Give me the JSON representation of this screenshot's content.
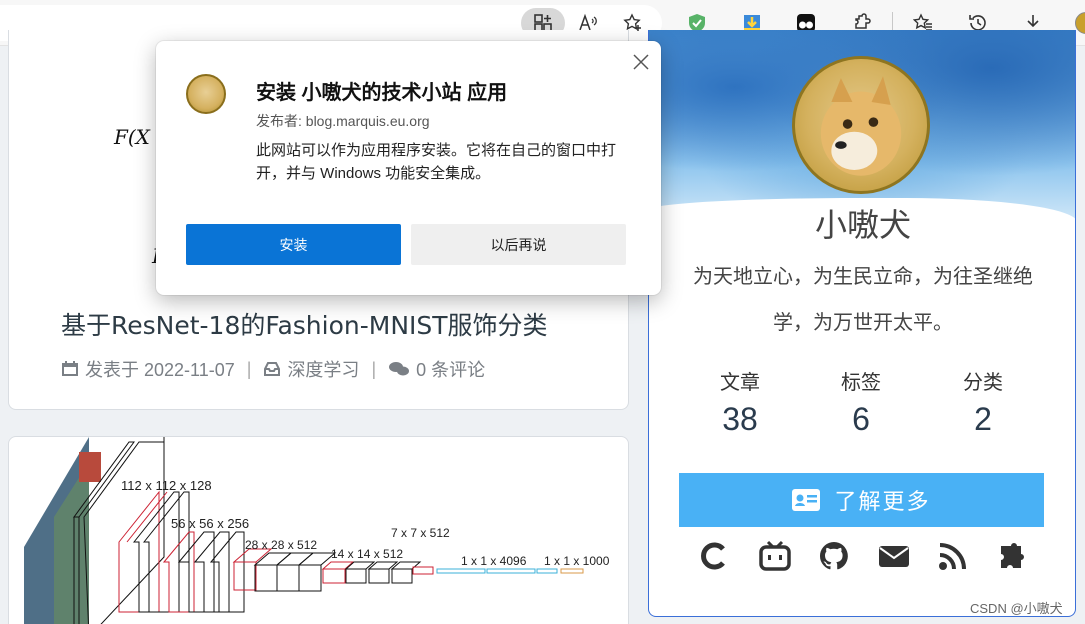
{
  "toolbar": {
    "icons": [
      "app-available-icon",
      "read-aloud-icon",
      "add-favorite-icon",
      "adguard-extension-icon",
      "download-extension-icon",
      "tampermonkey-extension-icon",
      "extensions-icon",
      "favorites-icon",
      "history-icon",
      "downloads-icon",
      "profile-avatar"
    ]
  },
  "post1": {
    "formula_top": "F(X",
    "formula_bottom": "F",
    "title": "基于ResNet-18的Fashion-MNIST服饰分类",
    "date_label": "发表于 2022-11-07",
    "separator": "|",
    "category": "深度学习",
    "comments": "0 条评论"
  },
  "post2": {
    "labels": [
      "112 x 112 x 128",
      "56 x 56 x 256",
      "28 x 28 x 512",
      "14 x 14 x 512",
      "7 x 7 x 512",
      "1 x 1 x 4096",
      "1 x 1 x 1000"
    ]
  },
  "profile": {
    "name": "小嗷犬",
    "motto": "为天地立心，为生民立命，为往圣继绝学，为万世开太平。",
    "stats": [
      {
        "label": "文章",
        "value": "38"
      },
      {
        "label": "标签",
        "value": "6"
      },
      {
        "label": "分类",
        "value": "2"
      }
    ],
    "learn_more": "了解更多",
    "social_icons": [
      "csdn-icon",
      "bilibili-icon",
      "github-icon",
      "email-icon",
      "rss-icon",
      "puzzle-icon"
    ]
  },
  "popup": {
    "title": "安装 小嗷犬的技术小站 应用",
    "publisher": "发布者: blog.marquis.eu.org",
    "description": "此网站可以作为应用程序安装。它将在自己的窗口中打开，并与 Windows 功能安全集成。",
    "install": "安装",
    "later": "以后再说"
  },
  "watermark": "CSDN @小嗷犬",
  "colors": {
    "accent": "#49b1f5",
    "install_button": "#0a74d6",
    "profile_border": "#3b6fd8"
  }
}
